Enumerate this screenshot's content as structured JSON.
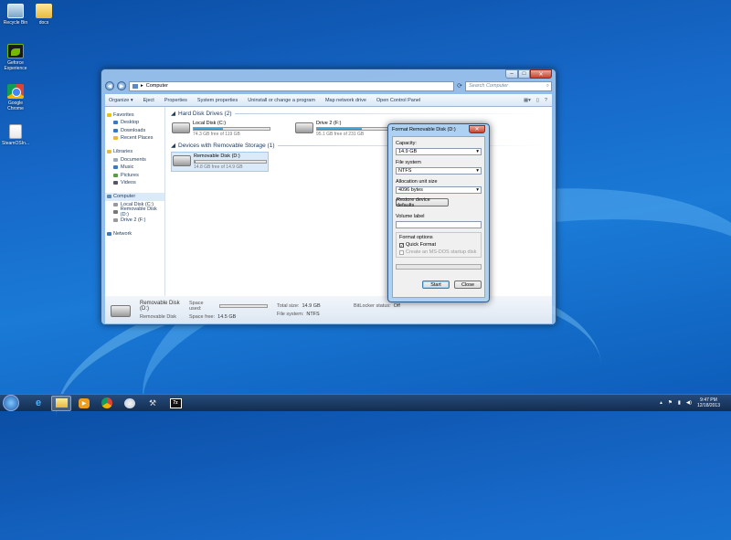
{
  "desktop": {
    "icons": [
      {
        "label": "Recycle Bin",
        "icon": "recycle-bin-icon"
      },
      {
        "label": "docs",
        "icon": "folder-icon"
      },
      {
        "label": "Geforce Experience",
        "icon": "nvidia-icon"
      },
      {
        "label": "Google Chrome",
        "icon": "chrome-icon"
      },
      {
        "label": "SteamOSIn...",
        "icon": "file-icon"
      }
    ]
  },
  "explorer": {
    "address": [
      "Computer"
    ],
    "search_placeholder": "Search Computer",
    "toolbar": [
      "Organize ▾",
      "Eject",
      "Properties",
      "System properties",
      "Uninstall or change a program",
      "Map network drive",
      "Open Control Panel"
    ],
    "nav": {
      "favorites": {
        "label": "Favorites",
        "items": [
          "Desktop",
          "Downloads",
          "Recent Places"
        ]
      },
      "libraries": {
        "label": "Libraries",
        "items": [
          "Documents",
          "Music",
          "Pictures",
          "Videos"
        ]
      },
      "computer": {
        "label": "Computer",
        "items": [
          "Local Disk (C:)",
          "Removable Disk (D:)",
          "Drive 2 (F:)"
        ]
      },
      "network": {
        "label": "Network"
      }
    },
    "hdd_section": "Hard Disk Drives (2)",
    "removable_section": "Devices with Removable Storage (1)",
    "drives": [
      {
        "name": "Local Disk (C:)",
        "free": "74.3 GB free of 119 GB",
        "used_fraction": 0.38
      },
      {
        "name": "Drive 2 (F:)",
        "free": "95.1 GB free of 231 GB",
        "used_fraction": 0.59
      }
    ],
    "removable": {
      "name": "Removable Disk (D:)",
      "free": "14.8 GB free of 14.9 GB",
      "used_fraction": 0.01
    },
    "details": {
      "name": "Removable Disk (D:)",
      "type": "Removable Disk",
      "space_used_label": "Space used:",
      "space_used_fraction": 0.01,
      "space_free_label": "Space free:",
      "space_free": "14.5 GB",
      "total_size_label": "Total size:",
      "total_size": "14.9 GB",
      "file_system_label": "File system:",
      "file_system": "NTFS",
      "bitlocker_label": "BitLocker status:",
      "bitlocker": "Off"
    }
  },
  "dialog": {
    "title": "Format Removable Disk (D:)",
    "capacity_label": "Capacity:",
    "capacity": "14.9 GB",
    "fs_label": "File system",
    "fs": "NTFS",
    "alloc_label": "Allocation unit size",
    "alloc": "4096 bytes",
    "restore": "Restore device defaults",
    "volume_label": "Volume label",
    "volume_value": "",
    "options_label": "Format options",
    "quick_format": "Quick Format",
    "msdos": "Create an MS-DOS startup disk",
    "start": "Start",
    "close": "Close"
  },
  "taskbar": {
    "time": "9:47 PM",
    "date": "12/18/2013"
  }
}
